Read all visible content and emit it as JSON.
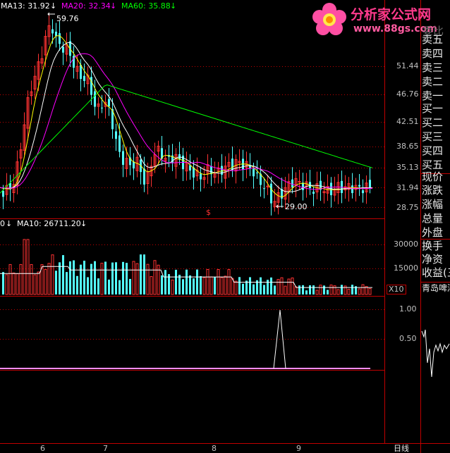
{
  "brand": {
    "title": "分析家公式网",
    "url": "www.88gs.com",
    "peek_text": "委比"
  },
  "indicators": {
    "ma13": "MA13: 31.92",
    "ma20": "MA20: 32.34",
    "ma60": "MA60: 35.88",
    "vol_prefix": "0",
    "ma10": "MA10: 26711.20"
  },
  "price_axis": [
    "51.44",
    "46.76",
    "42.51",
    "38.65",
    "35.13",
    "31.94",
    "28.75"
  ],
  "volume_axis": [
    "30000",
    "15000"
  ],
  "volume_unit": "X10",
  "osc_axis": [
    "1.00",
    "0.50"
  ],
  "annotations": {
    "high": "59.76",
    "low": "29.00"
  },
  "marker": "$",
  "date_labels": [
    "6",
    "7",
    "8",
    "9"
  ],
  "period_label": "日线",
  "sidebar": {
    "order_book": [
      "卖五",
      "卖四",
      "卖三",
      "卖二",
      "卖一",
      "买一",
      "买二",
      "买三",
      "买四",
      "买五"
    ],
    "quote": [
      "现价",
      "涨跌",
      "涨幅",
      "总量",
      "外盘"
    ],
    "stats": [
      "换手",
      "净资",
      "收益(三"
    ],
    "stock_name": "青岛啤酒"
  },
  "colors": {
    "up": "#ff3232",
    "down": "#54ffff",
    "ma13": "#ffffff",
    "ma20": "#ff00ff",
    "ma60": "#00ff00",
    "ma5": "#ffff00",
    "grid": "#c00000",
    "axis_text": "#c0c0c0"
  }
}
